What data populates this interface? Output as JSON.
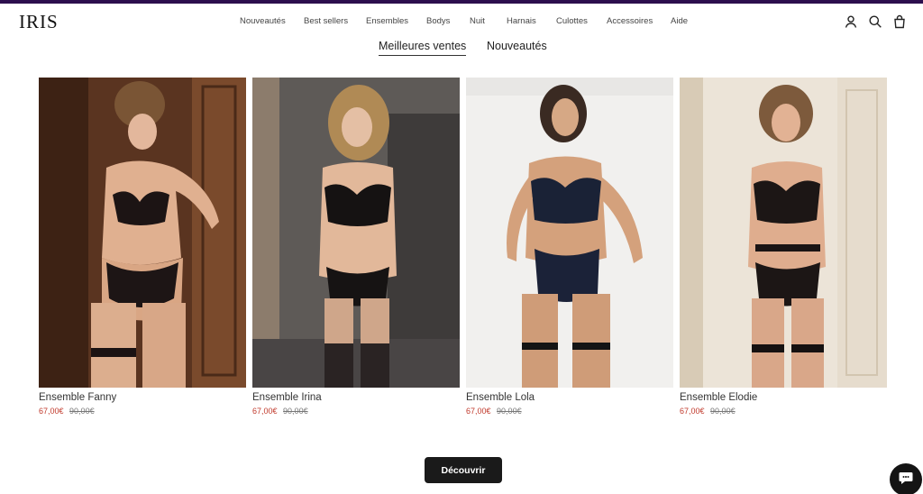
{
  "brand": {
    "logo": "IRIS"
  },
  "nav": {
    "items": [
      {
        "label": "Nouveautés"
      },
      {
        "label": "Best sellers"
      },
      {
        "label": "Ensembles"
      },
      {
        "label": "Bodys"
      },
      {
        "label": "Nuit"
      },
      {
        "label": "Harnais"
      },
      {
        "label": "Culottes"
      },
      {
        "label": "Accessoires"
      },
      {
        "label": "Aide"
      }
    ]
  },
  "header_icons": [
    "account-icon",
    "search-icon",
    "cart-icon"
  ],
  "tabs": [
    {
      "label": "Meilleures ventes",
      "active": true
    },
    {
      "label": "Nouveautés",
      "active": false
    }
  ],
  "products": [
    {
      "name": "Ensemble Fanny",
      "price": "67,00€",
      "compare_price": "90,00€"
    },
    {
      "name": "Ensemble Irina",
      "price": "67,00€",
      "compare_price": "90,00€"
    },
    {
      "name": "Ensemble Lola",
      "price": "67,00€",
      "compare_price": "90,00€"
    },
    {
      "name": "Ensemble Elodie",
      "price": "67,00€",
      "compare_price": "90,00€"
    }
  ],
  "cta": {
    "label": "Découvrir"
  },
  "colors": {
    "accent_bar": "#2c0f4e",
    "sale_price": "#c0392b",
    "button": "#1a1a1a"
  }
}
